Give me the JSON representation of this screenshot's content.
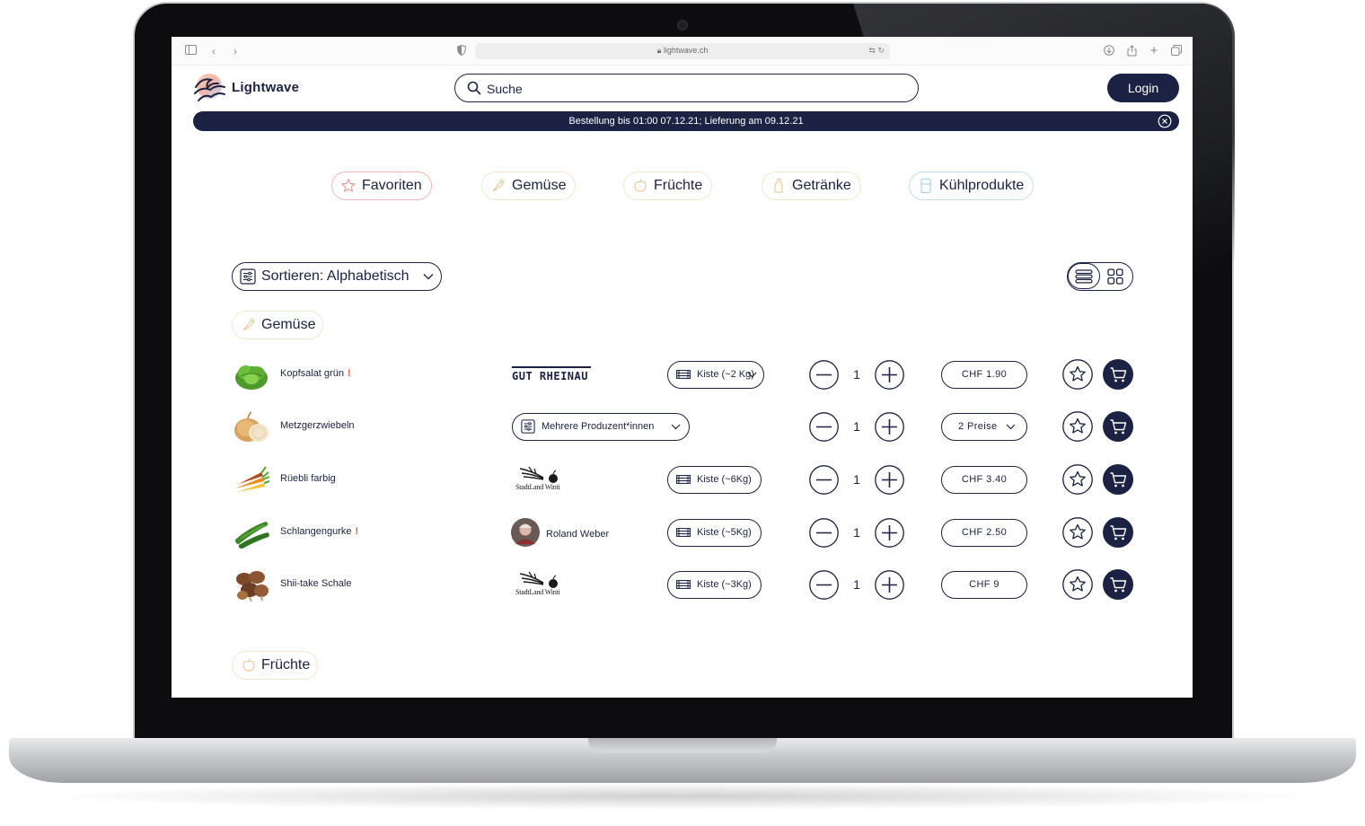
{
  "browser": {
    "url": "lightwave.ch"
  },
  "header": {
    "brand": "Lightwave",
    "search_placeholder": "Suche",
    "login_label": "Login"
  },
  "banner": {
    "text": "Bestellung bis 01:00 07.12.21; Lieferung am 09.12.21"
  },
  "categories": [
    {
      "label": "Favoriten",
      "icon": "star-icon",
      "color": "#f3b7b7"
    },
    {
      "label": "Gemüse",
      "icon": "carrot-icon",
      "color": "#f7e6cf"
    },
    {
      "label": "Früchte",
      "icon": "apple-icon",
      "color": "#f7e6cf"
    },
    {
      "label": "Getränke",
      "icon": "bottle-icon",
      "color": "#f7e6cf"
    },
    {
      "label": "Kühlprodukte",
      "icon": "fridge-icon",
      "color": "#bfe0f2"
    }
  ],
  "toolbar": {
    "sort_label": "Sortieren: Alphabetisch"
  },
  "sections": [
    {
      "label": "Gemüse"
    },
    {
      "label": "Früchte"
    }
  ],
  "products": [
    {
      "name": "Kopfsalat grün",
      "warning": "!",
      "producer": "GUT RHEINAU",
      "box": "Kiste (~2 Kg)",
      "quantity": "1",
      "price": "CHF  1.90"
    },
    {
      "name": "Metzgerzwiebeln",
      "warning": "",
      "producer": "Mehrere Produzent*innen",
      "box": "",
      "quantity": "1",
      "price": "2 Preise"
    },
    {
      "name": "Rüebli farbig",
      "warning": "",
      "producer": "StadtLand Winti",
      "box": "Kiste (~6Kg)",
      "quantity": "1",
      "price": "CHF  3.40"
    },
    {
      "name": "Schlangengurke",
      "warning": "!",
      "producer": "Roland Weber",
      "box": "Kiste (~5Kg)",
      "quantity": "1",
      "price": "CHF  2.50"
    },
    {
      "name": "Shii-take Schale",
      "warning": "",
      "producer": "StadtLand Winti",
      "box": "Kiste (~3Kg)",
      "quantity": "1",
      "price": "CHF  9"
    }
  ],
  "colors": {
    "navy": "#1b2243",
    "warning": "#e8572b"
  }
}
